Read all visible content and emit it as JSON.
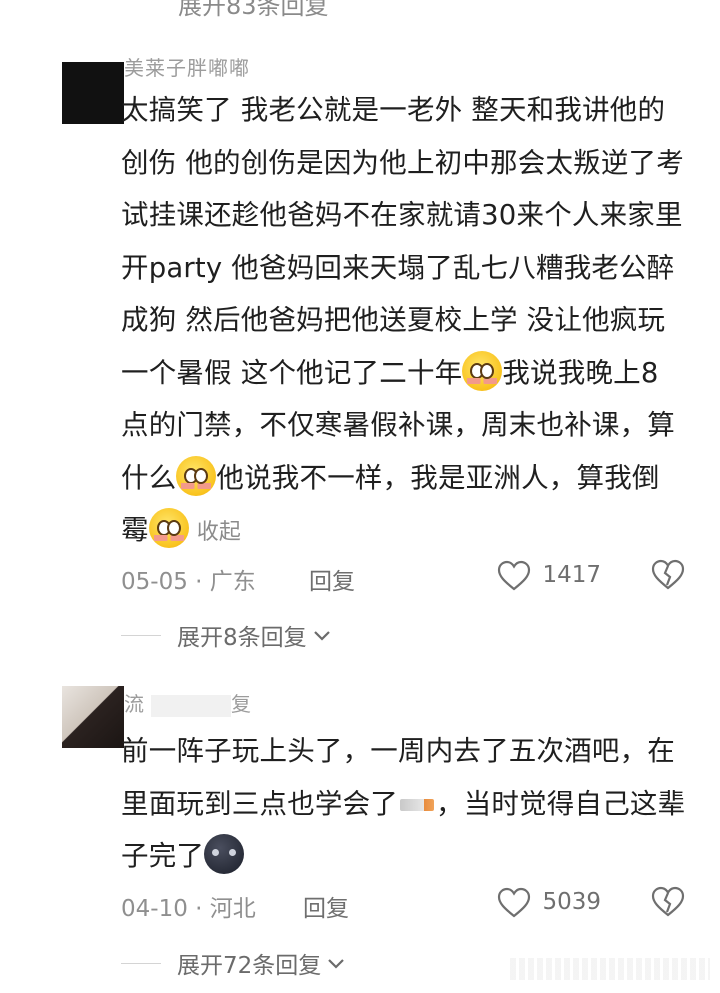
{
  "top": {
    "expand_text": "展开83条回复"
  },
  "comments": [
    {
      "username": "美莱子胖嘟嘟",
      "text_1": "太搞笑了 我老公就是一老外 整天和我讲他的创伤 他的创伤是因为他上初中那会太叛逆了考试挂课还趁他爸妈不在家就请30来个人来家里开party 他爸妈回来天塌了乱七八糟我老公醉成狗 然后他爸妈把他送夏校上学 没让他疯玩一个暑假 这个他记了二十年",
      "text_2": "我说我晚上8点的门禁，不仅寒暑假补课，周末也补课，算什么",
      "text_3": "他说我不一样，我是亚洲人，算我倒霉",
      "collapse": "收起",
      "date": "05-05",
      "location": "广东",
      "reply": "回复",
      "likes": "1417",
      "expand": "展开8条回复"
    },
    {
      "username": "流",
      "username_tail": "复",
      "text_1": "前一阵子玩上头了，一周内去了五次酒吧，在里面玩到三点也学会了",
      "text_2": "，当时觉得自己这辈子完了",
      "date": "04-10",
      "location": "河北",
      "reply": "回复",
      "likes": "5039",
      "expand": "展开72条回复"
    }
  ],
  "icons": {
    "heart": "heart-outline-icon",
    "dislike": "broken-heart-icon",
    "chevron": "chevron-down-icon",
    "emoji_smile": "blushing-smile-emoji",
    "emoji_dark": "dark-moon-face-emoji",
    "cigarette": "cigarette-emoji"
  },
  "colors": {
    "text": "#1f1f1f",
    "meta": "#8f8f8f",
    "muted": "#6b6b6b"
  }
}
